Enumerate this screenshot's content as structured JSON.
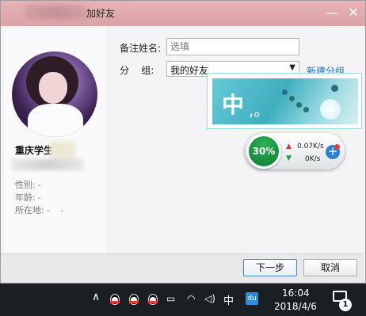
{
  "window": {
    "title": "加好友",
    "minimize_glyph": "—",
    "close_glyph": "✕"
  },
  "profile": {
    "nickname": "重庆学生",
    "info": [
      {
        "label": "性别:",
        "value": "-"
      },
      {
        "label": "年龄:",
        "value": "-"
      },
      {
        "label": "所在地:",
        "value": "-    -"
      }
    ]
  },
  "form": {
    "remark_label": "备注姓名:",
    "remark_placeholder": "选填",
    "group_label": "分    组:",
    "group_value": "我的好友",
    "new_group_link": "新建分组"
  },
  "ime_popup": {
    "char": "中",
    "punct": ",。"
  },
  "speed_widget": {
    "percent": "30%",
    "upload": "0.07K/s",
    "download": "0K/s",
    "plus": "+"
  },
  "buttons": {
    "next": "下一步",
    "cancel": "取消"
  },
  "taskbar": {
    "ime": "中",
    "du": "du",
    "time": "16:04",
    "date": "2018/4/6",
    "notifications": "1"
  },
  "colors": {
    "titlebar": "#dba3a6",
    "link": "#2a6fc1",
    "speed_green": "#0b7a35",
    "taskbar": "#1a1f24"
  }
}
